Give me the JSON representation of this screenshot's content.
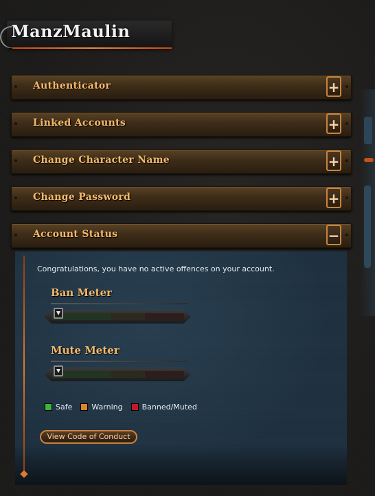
{
  "header": {
    "title": "ManzMaulin"
  },
  "accordion": [
    {
      "label": "Authenticator",
      "toggle": "+"
    },
    {
      "label": "Linked Accounts",
      "toggle": "+"
    },
    {
      "label": "Change Character Name",
      "toggle": "+"
    },
    {
      "label": "Change Password",
      "toggle": "+"
    },
    {
      "label": "Account Status",
      "toggle": "−",
      "expanded": true
    }
  ],
  "account_status": {
    "message": "Congratulations, you have no active offences on your account.",
    "ban_meter": {
      "title": "Ban Meter",
      "level": 0.0
    },
    "mute_meter": {
      "title": "Mute Meter",
      "level": 0.0
    },
    "legend": [
      {
        "label": "Safe",
        "color": "#3cb43c"
      },
      {
        "label": "Warning",
        "color": "#d9862a"
      },
      {
        "label": "Banned/Muted",
        "color": "#c0182a"
      }
    ],
    "code_of_conduct_button": "View Code of Conduct"
  },
  "colors": {
    "accent_orange": "#f3b86a",
    "panel_blue": "#1e3140",
    "meter_safe": "#223523",
    "meter_warning": "#2c2a1f",
    "meter_banned": "#2d1e1e"
  }
}
